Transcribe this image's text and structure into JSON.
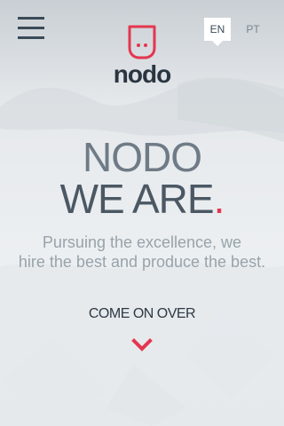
{
  "header": {
    "menu_icon": "hamburger-menu-icon",
    "logo_text": "nodo",
    "logo_icon": "nodo-face-icon",
    "languages": [
      {
        "label": "EN",
        "active": true
      },
      {
        "label": "PT",
        "active": false
      }
    ]
  },
  "hero": {
    "line1": "NODO",
    "line2": "WE ARE",
    "line2_dot": ".",
    "subtitle_line1": "Pursuing the excellence, we",
    "subtitle_line2": "hire the best and produce the best."
  },
  "cta": {
    "label": "COME ON OVER",
    "icon": "chevron-down-icon"
  },
  "colors": {
    "accent": "#e4364f",
    "heading": "#4b5864",
    "background": "#ebeef0"
  }
}
